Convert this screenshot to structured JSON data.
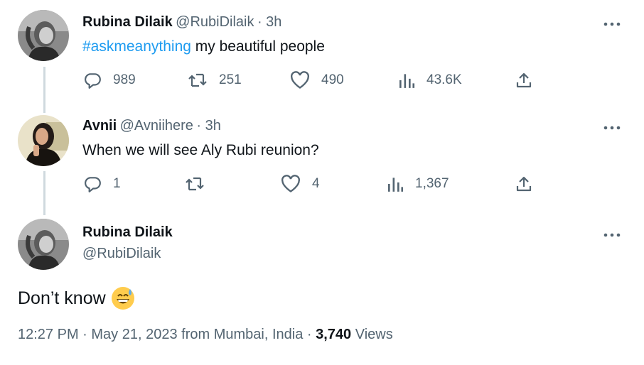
{
  "tweets": [
    {
      "author": "Rubina Dilaik",
      "handle": "@RubiDilaik",
      "time": "· 3h",
      "hashtag": "#askmeanything",
      "text": " my beautiful people",
      "replies": "989",
      "retweets": "251",
      "likes": "490",
      "views": "43.6K"
    },
    {
      "author": "Avnii",
      "handle": "@Avniihere",
      "time": "· 3h",
      "text": "When we will see Aly Rubi reunion?",
      "replies": "1",
      "retweets": "",
      "likes": "4",
      "views": "1,367"
    }
  ],
  "main_tweet": {
    "author": "Rubina Dilaik",
    "handle": "@RubiDilaik",
    "text": "Don’t know",
    "emoji": "grinning-face-with-sweat",
    "time": "12:27 PM",
    "date": "May 21, 2023",
    "location": "from Mumbai, India",
    "views_count": "3,740",
    "views_label": "Views"
  },
  "icons": {
    "reply": "reply-icon",
    "retweet": "retweet-icon",
    "like": "like-icon",
    "views": "views-icon",
    "share": "share-icon",
    "more": "more-icon"
  },
  "colors": {
    "link": "#1d9bf0",
    "secondary_text": "#536471",
    "thread_line": "#cfd9de"
  }
}
